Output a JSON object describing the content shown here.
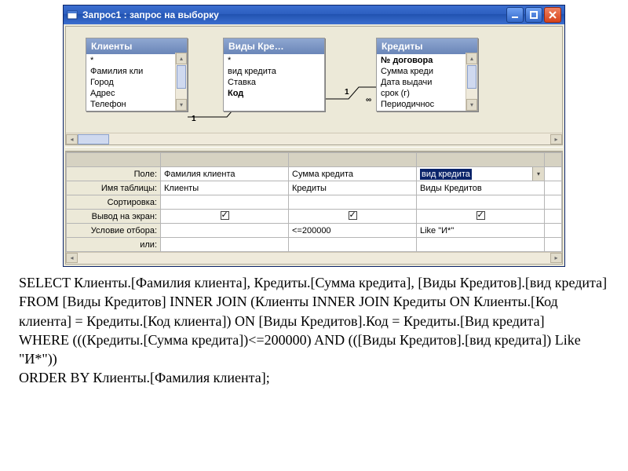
{
  "window": {
    "title": "Запрос1 : запрос на выборку"
  },
  "tables": {
    "t1": {
      "title": "Клиенты",
      "fields": [
        "*",
        "Фамилия кли",
        "Город",
        "Адрес",
        "Телефон"
      ]
    },
    "t2": {
      "title": "Виды Кре…",
      "fields": [
        "*",
        "вид кредита",
        "Ставка",
        "Код"
      ]
    },
    "t3": {
      "title": "Кредиты",
      "boldIdx": 0,
      "fields": [
        "№ договора",
        "Сумма креди",
        "Дата выдачи",
        "срок (г)",
        "Периодичнос"
      ]
    }
  },
  "joins": {
    "left": "1",
    "mid": "1",
    "right": "∞"
  },
  "qbe": {
    "labels": {
      "field": "Поле:",
      "table": "Имя таблицы:",
      "sort": "Сортировка:",
      "show": "Вывод на экран:",
      "criteria": "Условие отбора:",
      "or": "или:"
    },
    "cols": [
      {
        "field": "Фамилия клиента",
        "table": "Клиенты",
        "show": true,
        "criteria": ""
      },
      {
        "field": "Сумма кредита",
        "table": "Кредиты",
        "show": true,
        "criteria": "<=200000"
      },
      {
        "field": "вид кредита",
        "table": "Виды Кредитов",
        "show": true,
        "criteria": "Like \"И*\"",
        "highlighted": true,
        "dropdown": true
      }
    ]
  },
  "sql": {
    "l1": "SELECT Клиенты.[Фамилия клиента], Кредиты.[Сумма кредита], [Виды Кредитов].[вид кредита]",
    "l2": "FROM [Виды Кредитов] INNER JOIN (Клиенты INNER JOIN Кредиты ON Клиенты.[Код клиента] = Кредиты.[Код клиента]) ON [Виды Кредитов].Код = Кредиты.[Вид кредита]",
    "l3": "WHERE (((Кредиты.[Сумма кредита])<=200000) AND (([Виды Кредитов].[вид кредита]) Like \"И*\"))",
    "l4": "ORDER BY Клиенты.[Фамилия клиента];"
  }
}
